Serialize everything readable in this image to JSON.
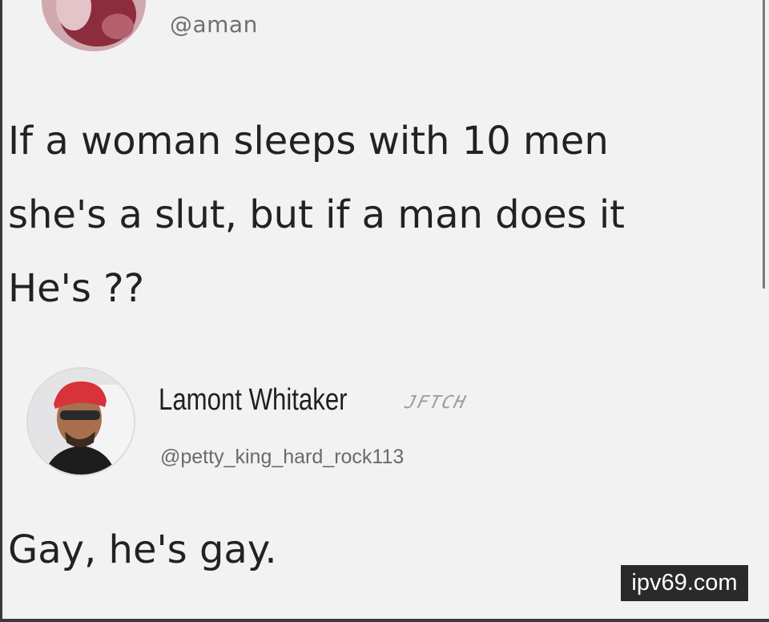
{
  "original_tweet": {
    "handle": "@aman",
    "lines": [
      "If a woman sleeps with 10 men",
      "she's a slut, but if a man does it",
      "He's ??"
    ]
  },
  "reply": {
    "display_name": "Lamont Whitaker",
    "stamp": "JFTCH",
    "handle": "@petty_king_hard_rock113",
    "text": "Gay, he's gay."
  },
  "watermark": "ipv69.com",
  "colors": {
    "background": "#f2f2f2",
    "text": "#222222",
    "handle": "#6f6f6f",
    "watermark_bg": "#2a2a2a"
  }
}
